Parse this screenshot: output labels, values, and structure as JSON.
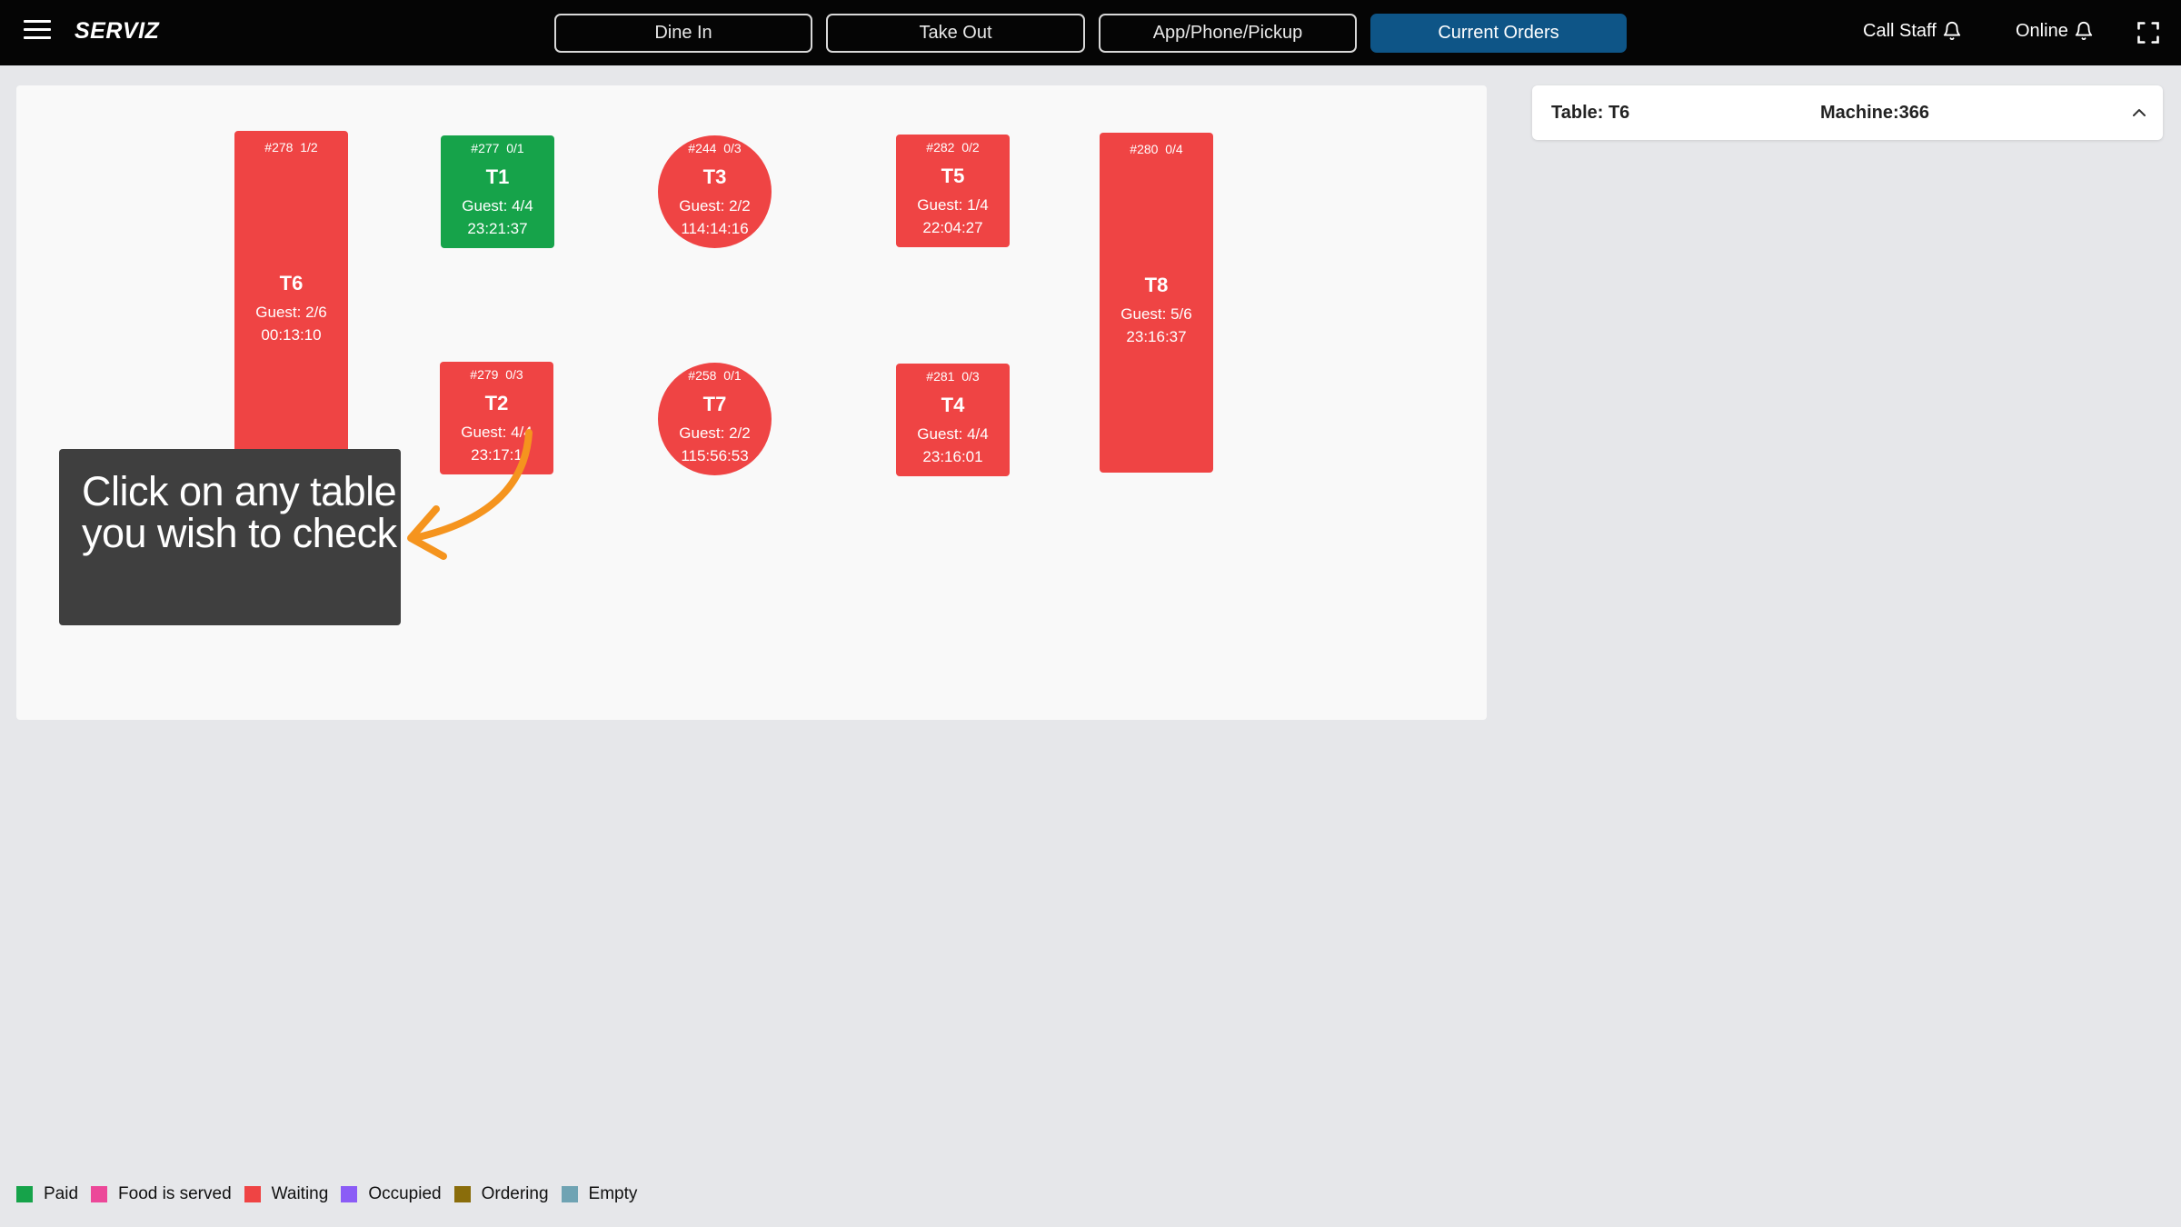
{
  "header": {
    "brand": "SERVIZ",
    "nav": [
      {
        "label": "Dine In",
        "active": false
      },
      {
        "label": "Take Out",
        "active": false
      },
      {
        "label": "App/Phone/Pickup",
        "active": false
      },
      {
        "label": "Current Orders",
        "active": true
      }
    ],
    "call_staff": "Call Staff",
    "online": "Online"
  },
  "tables": [
    {
      "id": "t6",
      "order": "#278",
      "count": "1/2",
      "name": "T6",
      "guest": "Guest: 2/6",
      "time": "00:13:10",
      "status": "Waiting",
      "color": "#ef4444"
    },
    {
      "id": "t1",
      "order": "#277",
      "count": "0/1",
      "name": "T1",
      "guest": "Guest: 4/4",
      "time": "23:21:37",
      "status": "Paid",
      "color": "#16a34a"
    },
    {
      "id": "t3",
      "order": "#244",
      "count": "0/3",
      "name": "T3",
      "guest": "Guest: 2/2",
      "time": "114:14:16",
      "status": "Waiting",
      "color": "#ef4444"
    },
    {
      "id": "t5",
      "order": "#282",
      "count": "0/2",
      "name": "T5",
      "guest": "Guest: 1/4",
      "time": "22:04:27",
      "status": "Waiting",
      "color": "#ef4444"
    },
    {
      "id": "t8",
      "order": "#280",
      "count": "0/4",
      "name": "T8",
      "guest": "Guest: 5/6",
      "time": "23:16:37",
      "status": "Waiting",
      "color": "#ef4444"
    },
    {
      "id": "t2",
      "order": "#279",
      "count": "0/3",
      "name": "T2",
      "guest": "Guest: 4/4",
      "time": "23:17:1",
      "status": "Waiting",
      "color": "#ef4444"
    },
    {
      "id": "t7",
      "order": "#258",
      "count": "0/1",
      "name": "T7",
      "guest": "Guest: 2/2",
      "time": "115:56:53",
      "status": "Waiting",
      "color": "#ef4444"
    },
    {
      "id": "t4",
      "order": "#281",
      "count": "0/3",
      "name": "T4",
      "guest": "Guest: 4/4",
      "time": "23:16:01",
      "status": "Waiting",
      "color": "#ef4444"
    }
  ],
  "tooltip": {
    "line1": "Click on any table",
    "line2": "you wish to check",
    "arrow_color": "#f5941e"
  },
  "detail": {
    "table": "Table: T6",
    "machine": "Machine:366"
  },
  "legend": [
    {
      "label": "Paid",
      "color": "#16a34a"
    },
    {
      "label": "Food is served",
      "color": "#ec4899"
    },
    {
      "label": "Waiting",
      "color": "#ef4444"
    },
    {
      "label": "Occupied",
      "color": "#8b5cf6"
    },
    {
      "label": "Ordering",
      "color": "#8a6d0b"
    },
    {
      "label": "Empty",
      "color": "#6fa3b3"
    }
  ]
}
